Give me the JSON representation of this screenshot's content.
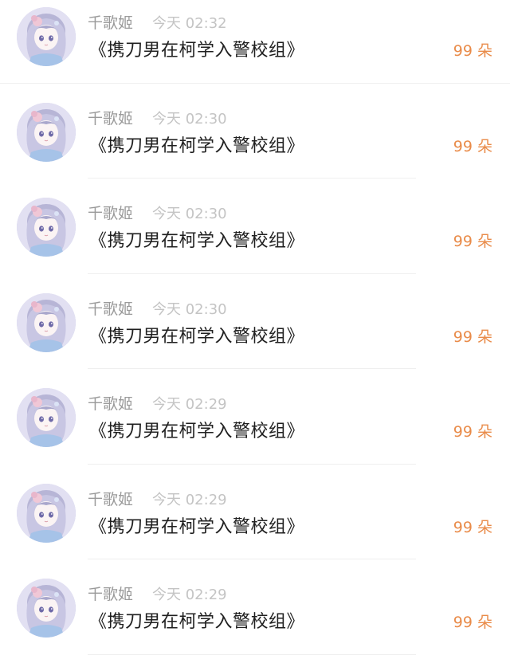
{
  "colors": {
    "name": "#9a9a9a",
    "time": "#c4c4c4",
    "title": "#1f1f1f",
    "count_accent": "#e98b49"
  },
  "gift_list": {
    "items": [
      {
        "avatar_icon": "anime-girl-avatar",
        "username": "千歌姬",
        "time": "今天 02:32",
        "title": "《携刀男在柯学入警校组》",
        "count": "99 朵"
      },
      {
        "avatar_icon": "anime-girl-avatar",
        "username": "千歌姬",
        "time": "今天 02:30",
        "title": "《携刀男在柯学入警校组》",
        "count": "99 朵"
      },
      {
        "avatar_icon": "anime-girl-avatar",
        "username": "千歌姬",
        "time": "今天 02:30",
        "title": "《携刀男在柯学入警校组》",
        "count": "99 朵"
      },
      {
        "avatar_icon": "anime-girl-avatar",
        "username": "千歌姬",
        "time": "今天 02:30",
        "title": "《携刀男在柯学入警校组》",
        "count": "99 朵"
      },
      {
        "avatar_icon": "anime-girl-avatar",
        "username": "千歌姬",
        "time": "今天 02:29",
        "title": "《携刀男在柯学入警校组》",
        "count": "99 朵"
      },
      {
        "avatar_icon": "anime-girl-avatar",
        "username": "千歌姬",
        "time": "今天 02:29",
        "title": "《携刀男在柯学入警校组》",
        "count": "99 朵"
      },
      {
        "avatar_icon": "anime-girl-avatar",
        "username": "千歌姬",
        "time": "今天 02:29",
        "title": "《携刀男在柯学入警校组》",
        "count": "99 朵"
      }
    ]
  }
}
